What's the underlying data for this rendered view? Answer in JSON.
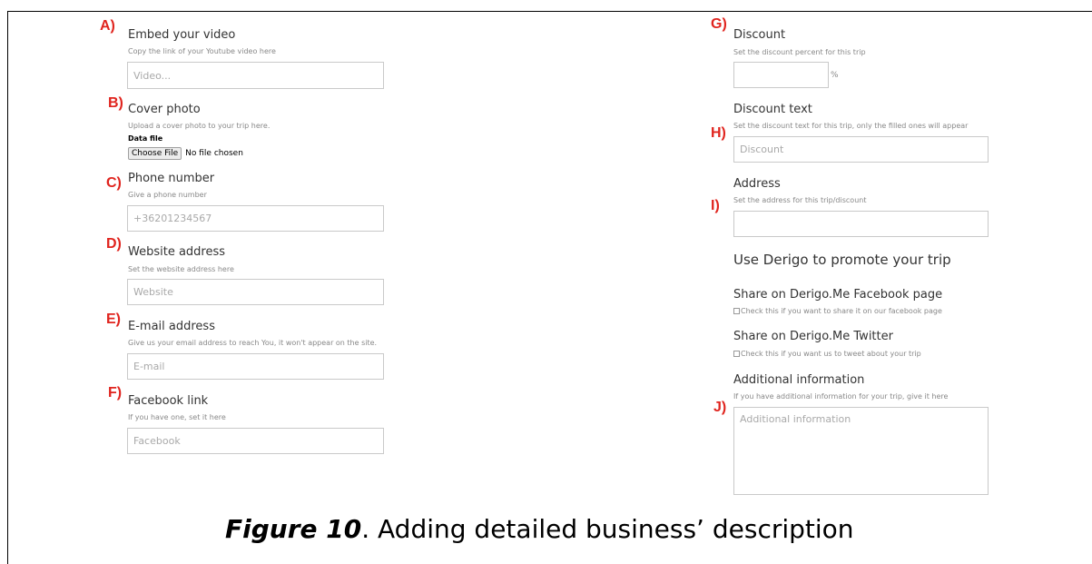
{
  "left": {
    "a": {
      "letter": "A)",
      "title": "Embed your video",
      "hint": "Copy the link of your Youtube video here",
      "placeholder": "Video..."
    },
    "b": {
      "letter": "B)",
      "title": "Cover photo",
      "hint": "Upload a cover photo to your trip here.",
      "data_label": "Data file",
      "button": "Choose File",
      "file_status": "No file chosen"
    },
    "c": {
      "letter": "C)",
      "title": "Phone number",
      "hint": "Give a phone number",
      "placeholder": "+36201234567"
    },
    "d": {
      "letter": "D)",
      "title": "Website address",
      "hint": "Set the website address here",
      "placeholder": "Website"
    },
    "e": {
      "letter": "E)",
      "title": "E-mail address",
      "hint": "Give us your email address to reach You, it won't appear on the site.",
      "placeholder": "E-mail"
    },
    "f": {
      "letter": "F)",
      "title": "Facebook link",
      "hint": "If you have one, set it here",
      "placeholder": "Facebook"
    }
  },
  "right": {
    "g": {
      "letter": "G)",
      "title": "Discount",
      "hint": "Set the discount percent for this trip",
      "unit": "%"
    },
    "h": {
      "letter": "H)",
      "title": "Discount text",
      "hint": "Set the discount text for this trip, only the filled ones will appear",
      "placeholder": "Discount"
    },
    "i": {
      "letter": "I)",
      "title": "Address",
      "hint": "Set the address for this trip/discount"
    },
    "promote": {
      "heading": "Use Derigo to promote your trip"
    },
    "facebook": {
      "title": "Share on Derigo.Me Facebook page",
      "hint": "Check this if you want to share it on our facebook page"
    },
    "twitter": {
      "title": "Share on Derigo.Me Twitter",
      "hint": "Check this if you want us to tweet about your trip"
    },
    "j": {
      "letter": "J)",
      "title": "Additional information",
      "hint": "If you have additional information for your trip, give it here",
      "placeholder": "Additional information"
    }
  },
  "caption": {
    "figure": "Figure 10",
    "text": ". Adding detailed business’ description"
  }
}
